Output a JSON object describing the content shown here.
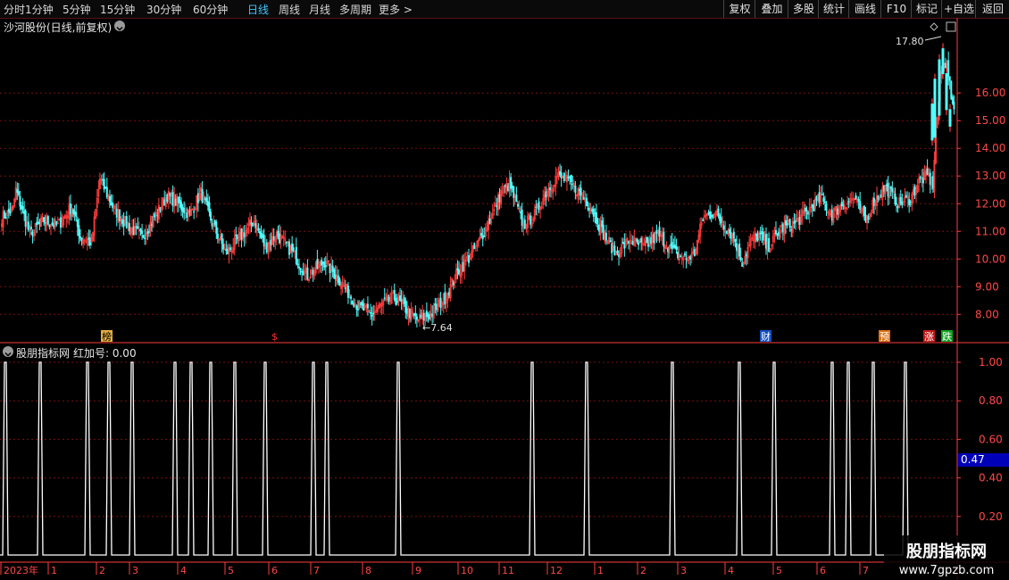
{
  "toolbar": {
    "periods": [
      "分时",
      "1分钟",
      "5分钟",
      "15分钟",
      "30分钟",
      "60分钟",
      "日线",
      "周线",
      "月线",
      "多周期",
      "更多 >"
    ],
    "active_period": "日线",
    "right_buttons": [
      "复权",
      "叠加",
      "多股",
      "统计",
      "画线",
      "F10",
      "标记",
      "+自选",
      "返回"
    ]
  },
  "stock": {
    "title": "沙河股份(日线,前复权)",
    "high_label": "17.80",
    "low_label": "7.64"
  },
  "indicator": {
    "title": "股朋指标网",
    "value_text": "红加号: 0.00",
    "current_value": "0.47"
  },
  "markers": [
    {
      "label": "榜",
      "color": "#e8b040",
      "text_color": "#000"
    },
    {
      "label": "$",
      "color": "#000",
      "text_color": "#ff3030"
    },
    {
      "label": "财",
      "color": "#1050c0",
      "text_color": "#fff"
    },
    {
      "label": "预",
      "color": "#e07010",
      "text_color": "#fff"
    },
    {
      "label": "涨",
      "color": "#c01818",
      "text_color": "#fff"
    },
    {
      "label": "跌",
      "color": "#10a020",
      "text_color": "#fff"
    }
  ],
  "watermark": {
    "line1": "股朋指标网",
    "line2": "www.7gpzb.com"
  },
  "colors": {
    "up": "#ff3c3c",
    "down": "#50ffff",
    "grid": "#7a1010",
    "axis": "#ff3c3c",
    "signal": "#ffffff",
    "accent": "#3ec8ff"
  },
  "chart_data": [
    {
      "type": "candlestick",
      "y_ticks": [
        "16.00",
        "15.00",
        "14.00",
        "13.00",
        "12.00",
        "11.00",
        "10.00",
        "9.00",
        "8.00"
      ],
      "ylim": [
        7.3,
        18.2
      ],
      "x_axis_labels": [
        "2023年",
        "1",
        "2",
        "3",
        "4",
        "5",
        "6",
        "7",
        "8",
        "9",
        "10",
        "11",
        "12",
        "1",
        "2",
        "3",
        "4",
        "5",
        "6",
        "7"
      ],
      "high": 17.8,
      "low": 7.64,
      "anchors": [
        [
          0,
          11.5
        ],
        [
          8,
          11.8
        ],
        [
          10,
          12.5
        ],
        [
          20,
          10.9
        ],
        [
          30,
          11.4
        ],
        [
          40,
          11.2
        ],
        [
          50,
          11.9
        ],
        [
          56,
          10.8
        ],
        [
          64,
          10.6
        ],
        [
          70,
          12.9
        ],
        [
          80,
          11.8
        ],
        [
          90,
          11.2
        ],
        [
          100,
          10.8
        ],
        [
          110,
          11.6
        ],
        [
          118,
          12.3
        ],
        [
          126,
          12.0
        ],
        [
          134,
          11.6
        ],
        [
          142,
          12.4
        ],
        [
          150,
          11.3
        ],
        [
          160,
          10.2
        ],
        [
          172,
          10.9
        ],
        [
          180,
          11.4
        ],
        [
          188,
          10.4
        ],
        [
          196,
          10.9
        ],
        [
          208,
          10.2
        ],
        [
          218,
          9.4
        ],
        [
          230,
          9.9
        ],
        [
          240,
          9.3
        ],
        [
          254,
          8.3
        ],
        [
          264,
          8.0
        ],
        [
          272,
          8.4
        ],
        [
          280,
          8.6
        ],
        [
          288,
          8.2
        ],
        [
          296,
          7.8
        ],
        [
          306,
          8.0
        ],
        [
          316,
          8.6
        ],
        [
          326,
          9.6
        ],
        [
          334,
          10.1
        ],
        [
          340,
          10.6
        ],
        [
          350,
          11.6
        ],
        [
          356,
          12.4
        ],
        [
          362,
          12.7
        ],
        [
          372,
          11.2
        ],
        [
          380,
          11.6
        ],
        [
          388,
          12.4
        ],
        [
          396,
          13.0
        ],
        [
          404,
          12.8
        ],
        [
          412,
          12.4
        ],
        [
          420,
          11.9
        ],
        [
          428,
          11.0
        ],
        [
          438,
          10.2
        ],
        [
          448,
          10.7
        ],
        [
          458,
          10.4
        ],
        [
          468,
          10.9
        ],
        [
          478,
          10.3
        ],
        [
          488,
          10.0
        ],
        [
          494,
          10.2
        ],
        [
          500,
          11.5
        ],
        [
          508,
          11.7
        ],
        [
          514,
          11.3
        ],
        [
          522,
          10.8
        ],
        [
          528,
          9.9
        ],
        [
          534,
          10.6
        ],
        [
          540,
          10.9
        ],
        [
          546,
          10.4
        ],
        [
          556,
          11.1
        ],
        [
          566,
          11.3
        ],
        [
          576,
          11.8
        ],
        [
          584,
          12.2
        ],
        [
          592,
          11.6
        ],
        [
          600,
          12.0
        ],
        [
          608,
          12.2
        ],
        [
          616,
          11.4
        ],
        [
          622,
          12.1
        ],
        [
          630,
          12.6
        ],
        [
          640,
          12.0
        ],
        [
          648,
          12.2
        ],
        [
          654,
          12.8
        ],
        [
          660,
          13.0
        ],
        [
          664,
          12.7
        ],
        [
          666,
          14.6
        ],
        [
          670,
          16.8
        ],
        [
          674,
          17.2
        ],
        [
          678,
          15.4
        ]
      ],
      "signal_indices": [
        3,
        20,
        51,
        59,
        76,
        94,
        104,
        114,
        132,
        150,
        180,
        185,
        226,
        302,
        337,
        384,
        425,
        445,
        479,
        489,
        500
      ]
    }
  ]
}
